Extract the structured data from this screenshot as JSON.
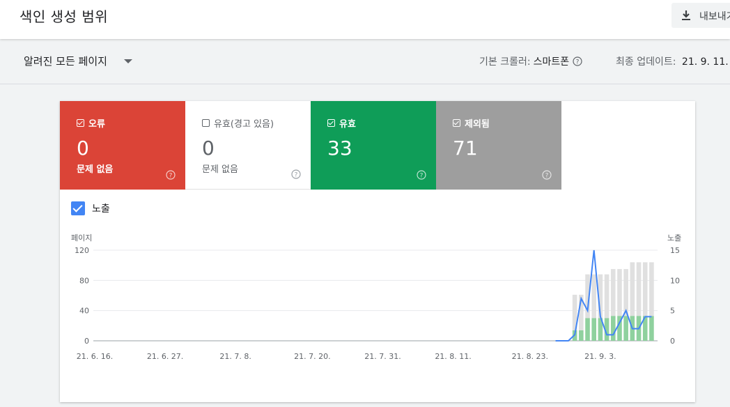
{
  "header": {
    "title": "색인 생성 범위",
    "export_label": "내보내기"
  },
  "filter": {
    "selected": "알려진 모든 페이지",
    "crawler_label": "기본 크롤러:",
    "crawler_value": "스마트폰",
    "updated_label": "최종 업데이트:",
    "updated_value": "21. 9. 11."
  },
  "tiles": [
    {
      "label": "오류",
      "count": "0",
      "sub": "문제 없음",
      "checked": true,
      "color": "#db4437"
    },
    {
      "label": "유효(경고 있음)",
      "count": "0",
      "sub": "문제 없음",
      "checked": false,
      "color": "#ffffff"
    },
    {
      "label": "유효",
      "count": "33",
      "sub": "",
      "checked": true,
      "color": "#0f9d58"
    },
    {
      "label": "제외됨",
      "count": "71",
      "sub": "",
      "checked": true,
      "color": "#9e9e9e"
    }
  ],
  "impressions": {
    "label": "노출",
    "checked": true
  },
  "chart_data": {
    "type": "bar",
    "y_left_label": "페이지",
    "y_right_label": "노출",
    "y_left_ticks": [
      0,
      40,
      80,
      120
    ],
    "y_right_ticks": [
      0,
      5,
      10,
      15
    ],
    "ylim_left": [
      0,
      120
    ],
    "ylim_right": [
      0,
      15
    ],
    "x_tick_labels": [
      "21. 6. 16.",
      "21. 6. 27.",
      "21. 7. 8.",
      "21. 7. 20.",
      "21. 7. 31.",
      "21. 8. 11.",
      "21. 8. 23.",
      "21. 9. 3."
    ],
    "bar_dates": [
      "21. 8. 30.",
      "21. 8. 31.",
      "21. 9. 1.",
      "21. 9. 2.",
      "21. 9. 3.",
      "21. 9. 4.",
      "21. 9. 5.",
      "21. 9. 6.",
      "21. 9. 7.",
      "21. 9. 8.",
      "21. 9. 9.",
      "21. 9. 10.",
      "21. 9. 11."
    ],
    "series": [
      {
        "name": "유효",
        "color": "#8fd19e",
        "values": [
          14,
          14,
          30,
          30,
          30,
          30,
          33,
          33,
          33,
          33,
          33,
          33,
          33
        ]
      },
      {
        "name": "제외됨",
        "color": "#e0e0e0",
        "values": [
          47,
          47,
          58,
          58,
          58,
          58,
          62,
          62,
          62,
          71,
          71,
          71,
          71
        ]
      }
    ],
    "line": {
      "name": "노출",
      "color": "#4285f4",
      "dates": [
        "21. 8. 27.",
        "21. 8. 28.",
        "21. 8. 29.",
        "21. 8. 30.",
        "21. 8. 31.",
        "21. 9. 1.",
        "21. 9. 2.",
        "21. 9. 3.",
        "21. 9. 4.",
        "21. 9. 5.",
        "21. 9. 6.",
        "21. 9. 7.",
        "21. 9. 8.",
        "21. 9. 9.",
        "21. 9. 10.",
        "21. 9. 11."
      ],
      "values": [
        0,
        0,
        0,
        1,
        7,
        5,
        15,
        4,
        1,
        1,
        3,
        5,
        2,
        2,
        4,
        4
      ]
    },
    "grid": true
  },
  "colors": {
    "accent_blue": "#4285f4",
    "error_red": "#db4437",
    "valid_green": "#0f9d58",
    "excluded_grey": "#9e9e9e"
  }
}
